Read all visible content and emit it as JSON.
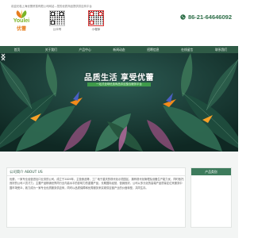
{
  "header": {
    "tagline": "欢迎光临上海优蕾贸易有限公司网站—您的优质商品提供供应商平台",
    "logo": {
      "en": "Youlei",
      "cn": "优蕾"
    },
    "qr_codes": [
      {
        "label": "公众号"
      },
      {
        "label": "小程序"
      }
    ],
    "phone": "86-21-64646092"
  },
  "nav": {
    "items": [
      "首页",
      "关于我们",
      "产品中心",
      "新闻动态",
      "招聘信息",
      "在线留言",
      "联系我们"
    ]
  },
  "banner": {
    "title": "品质生活 享受优蕾",
    "subtitle": "一站式全球优选商品供应整合服务平台"
  },
  "about": {
    "title": "公司简介 ABOUT US",
    "text": "优蕾，一家专业经营进出口业务的公司，成立于2009年，主营食品等，工厂地于重庆的现代化示范园区，拥有现代化管理及设备生产能力优，同时依托良好的公司人员才力，主要产品畅销世界同行业内高水平的影响力的重要产品，长期国际经营，营销良好。公司以多元化的高端产品质量定位来服务中国市场受众，致力成为一家专业优质服务供应商，同时以品质保障和优秀服务来实现供应链产业的价值转型，共同生存。"
  },
  "categories": {
    "title": "产品类别"
  },
  "colors": {
    "nav_bg": "#2f5b46",
    "accent_green": "#3d7b5c",
    "logo_green": "#7ab427",
    "logo_orange": "#e67d1e",
    "phone_color": "#2d6e48"
  }
}
